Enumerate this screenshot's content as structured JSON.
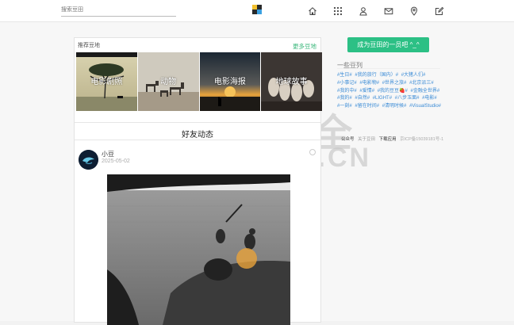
{
  "header": {
    "search_placeholder": "搜索豆田",
    "icons": [
      "logo-icon",
      "home-icon",
      "apps-icon",
      "user-icon",
      "mail-icon",
      "location-icon",
      "edit-icon"
    ]
  },
  "recommend": {
    "title": "推荐豆地",
    "more": "更多豆地",
    "albums": [
      {
        "label": "电影剧照"
      },
      {
        "label": "动物"
      },
      {
        "label": "电影海报"
      },
      {
        "label": "地球故事"
      }
    ]
  },
  "feed": {
    "title": "好友动态",
    "post": {
      "user": "小豆",
      "date": "2025-05-02"
    }
  },
  "sidebar": {
    "join_button": "成为豆田的一员吧 ^_^",
    "section_title": "一些豆列",
    "tags": [
      "#生日#",
      "#我的旅行（国内）#",
      "#大猪人们#",
      "#小事记#",
      "#电影物#",
      "#世界之旅#",
      "#北京派三#",
      "#我的中#",
      "#爱情#",
      "#我的豆豆🍓#",
      "#金融全世界#",
      "#我的#",
      "#自然#",
      "#LIGHT#",
      "#八步玉面#",
      "#电影#",
      "#一刻#",
      "#留在时间#",
      "#清明时候#",
      "#VisualStudio#"
    ],
    "footer": [
      "公众号",
      "关于豆田",
      "下载应用",
      "京ICP备15039181号-1"
    ]
  },
  "watermark": {
    "cn": "周博通大全",
    "en": "ZHOUBLOG.CN"
  },
  "colors": {
    "accent": "#2cc085",
    "link": "#3a8bd6"
  }
}
